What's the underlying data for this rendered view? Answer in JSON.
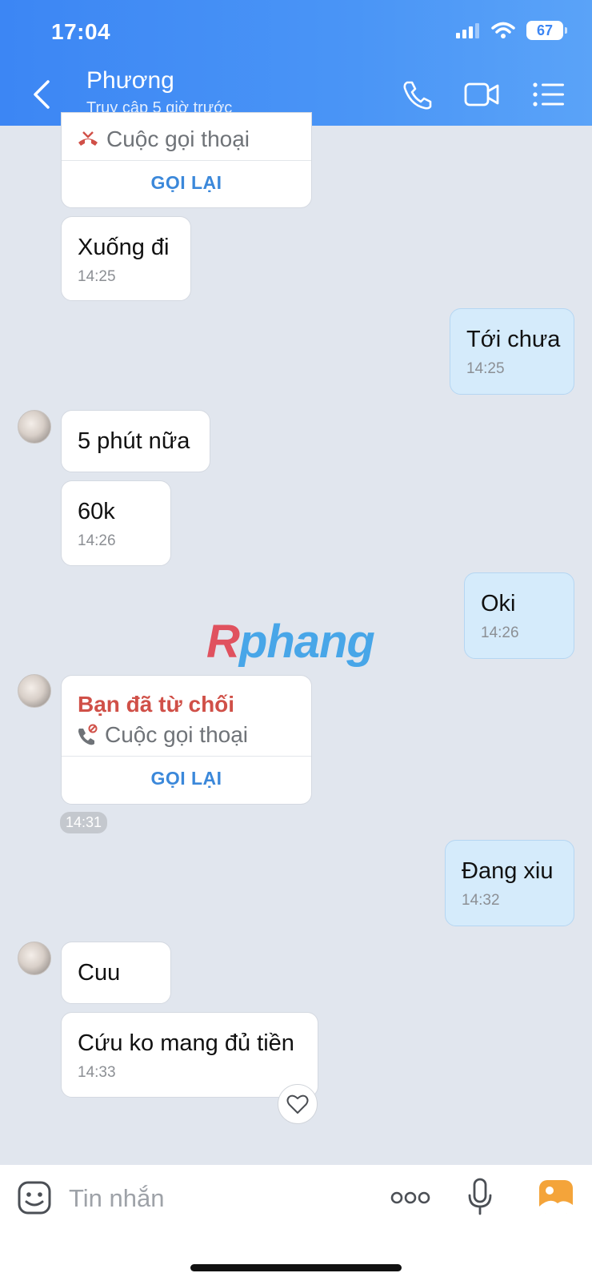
{
  "status_bar": {
    "time": "17:04",
    "battery": "67"
  },
  "header": {
    "contact_name": "Phương",
    "contact_status": "Truy cập 5 giờ trước",
    "icons": [
      "back-icon",
      "phone-icon",
      "video-icon",
      "menu-icon"
    ]
  },
  "messages": {
    "top_call": {
      "label": "Cuộc gọi thoại",
      "button": "GỌI LẠI"
    },
    "m1": {
      "text": "Xuống đi",
      "time": "14:25"
    },
    "m2": {
      "text": "Tới chưa",
      "time": "14:25"
    },
    "m3": {
      "text": "5 phút nữa"
    },
    "m4": {
      "text": "60k",
      "time": "14:26"
    },
    "m5": {
      "text": "Oki",
      "time": "14:26"
    },
    "call2": {
      "title": "Bạn đã từ chối",
      "label": "Cuộc gọi thoại",
      "button": "GỌI LẠI",
      "time": "14:31"
    },
    "m6": {
      "text": "Đang xiu",
      "time": "14:32"
    },
    "m7": {
      "text": "Cuu"
    },
    "m8": {
      "text": "Cứu ko mang đủ tiền",
      "time": "14:33"
    }
  },
  "watermark": {
    "part1": "R",
    "part2": "phang"
  },
  "composer": {
    "placeholder": "Tin nhắn"
  },
  "colors": {
    "header": "#3c86f4",
    "mine_bubble": "#d5ebfb",
    "background": "#e1e6ee",
    "decline_red": "#d05048",
    "link_blue": "#3b88da"
  }
}
